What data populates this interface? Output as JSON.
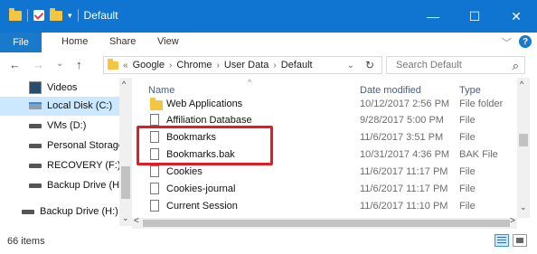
{
  "window": {
    "title": "Default",
    "minimize_glyph": "—",
    "maximize_glyph": "☐",
    "close_glyph": "✕",
    "accent_color": "#0f75d1"
  },
  "ribbon": {
    "tabs": [
      "File",
      "Home",
      "Share",
      "View"
    ],
    "collapse_glyph": "﹀",
    "help_glyph": "?"
  },
  "address": {
    "back_glyph": "←",
    "forward_glyph": "→",
    "recent_glyph": "⌄",
    "up_glyph": "↑",
    "overflow": "«",
    "crumbs": [
      "Google",
      "Chrome",
      "User Data",
      "Default"
    ],
    "crumb_sep": "›",
    "dropdown_glyph": "⌄",
    "refresh_glyph": "↻",
    "search_placeholder": "Search Default",
    "search_glyph": "⌕"
  },
  "nav_pane": {
    "items": [
      {
        "label": "Videos",
        "icon": "videos-icon"
      },
      {
        "label": "Local Disk (C:)",
        "icon": "local-disk-icon"
      },
      {
        "label": "VMs (D:)",
        "icon": "drive-icon"
      },
      {
        "label": "Personal Storage",
        "icon": "drive-icon"
      },
      {
        "label": "RECOVERY (F:)",
        "icon": "drive-icon"
      },
      {
        "label": "Backup Drive (H",
        "icon": "drive-icon"
      },
      {
        "label": "Backup Drive (H:)",
        "icon": "drive-icon"
      }
    ],
    "scroll_up_glyph": "^",
    "scroll_down_glyph": "⌄"
  },
  "file_list": {
    "columns": {
      "name": "Name",
      "date": "Date modified",
      "type": "Type"
    },
    "sort_glyph": "^",
    "rows": [
      {
        "name": "Web Applications",
        "date": "10/12/2017 2:56 PM",
        "type": "File folder",
        "icon": "folder-icon"
      },
      {
        "name": "Affiliation Database",
        "date": "9/28/2017 5:00 PM",
        "type": "File",
        "icon": "file-icon"
      },
      {
        "name": "Bookmarks",
        "date": "11/6/2017 3:51 PM",
        "type": "File",
        "icon": "file-icon"
      },
      {
        "name": "Bookmarks.bak",
        "date": "10/31/2017 4:36 PM",
        "type": "BAK File",
        "icon": "file-icon"
      },
      {
        "name": "Cookies",
        "date": "11/6/2017 11:17 PM",
        "type": "File",
        "icon": "file-icon"
      },
      {
        "name": "Cookies-journal",
        "date": "11/6/2017 11:17 PM",
        "type": "File",
        "icon": "file-icon"
      },
      {
        "name": "Current Session",
        "date": "11/6/2017 11:10 PM",
        "type": "File",
        "icon": "file-icon"
      }
    ],
    "scroll_up_glyph": "^",
    "scroll_down_glyph": "⌄",
    "scroll_left_glyph": "<",
    "scroll_right_glyph": ">",
    "highlight_color": "#e11c24"
  },
  "status": {
    "item_count": "66 items"
  }
}
